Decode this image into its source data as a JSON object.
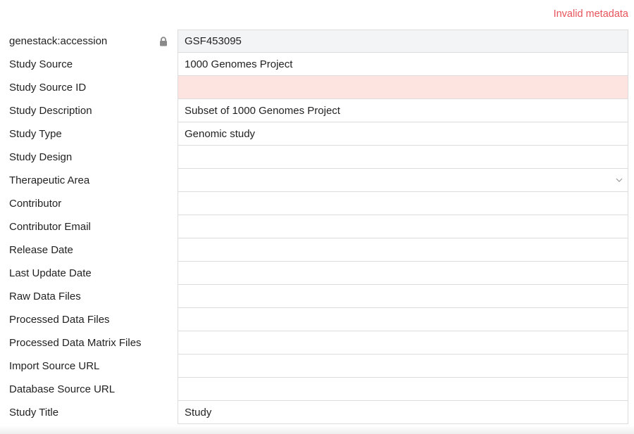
{
  "status": {
    "message": "Invalid metadata",
    "color": "#e8525a"
  },
  "colors": {
    "readonly_bg": "#f3f4f6",
    "invalid_bg": "#fde4e1",
    "border": "#dcdcdc"
  },
  "fields": [
    {
      "label": "genestack:accession",
      "value": "GSF453095",
      "state": "readonly",
      "icon": "lock-icon"
    },
    {
      "label": "Study Source",
      "value": "1000 Genomes Project"
    },
    {
      "label": "Study Source ID",
      "value": "",
      "state": "invalid"
    },
    {
      "label": "Study Description",
      "value": "Subset of 1000 Genomes Project"
    },
    {
      "label": "Study Type",
      "value": "Genomic study"
    },
    {
      "label": "Study Design",
      "value": ""
    },
    {
      "label": "Therapeutic Area",
      "value": "",
      "control": "dropdown",
      "icon": "chevron-down-icon"
    },
    {
      "label": "Contributor",
      "value": ""
    },
    {
      "label": "Contributor Email",
      "value": ""
    },
    {
      "label": "Release Date",
      "value": ""
    },
    {
      "label": "Last Update Date",
      "value": ""
    },
    {
      "label": "Raw Data Files",
      "value": ""
    },
    {
      "label": "Processed Data Files",
      "value": ""
    },
    {
      "label": "Processed Data Matrix Files",
      "value": ""
    },
    {
      "label": "Import Source URL",
      "value": ""
    },
    {
      "label": "Database Source URL",
      "value": ""
    },
    {
      "label": "Study Title",
      "value": "Study"
    }
  ]
}
